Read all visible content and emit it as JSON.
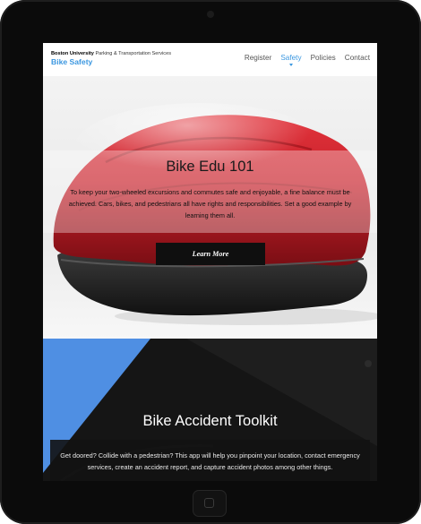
{
  "header": {
    "org_bold": "Boston University",
    "org_rest": "Parking & Transportation Services",
    "site_title": "Bike Safety"
  },
  "nav": {
    "items": [
      {
        "label": "Register",
        "active": false
      },
      {
        "label": "Safety",
        "active": true
      },
      {
        "label": "Policies",
        "active": false
      },
      {
        "label": "Contact",
        "active": false
      }
    ]
  },
  "hero": {
    "title": "Bike Edu 101",
    "body": "To keep your two-wheeled excursions and commutes safe and enjoyable, a fine balance must be achieved. Cars, bikes, and pedestrians all have rights and responsibilities. Set a good example by learning them all.",
    "button_label": "Learn More"
  },
  "toolkit": {
    "title": "Bike Accident Toolkit",
    "body": "Get doored? Collide with a pedestrian? This app will help you pinpoint your location, contact emergency services, create an accident report, and capture accident photos among other things."
  },
  "colors": {
    "accent": "#3b97e0",
    "toolkit_bg": "#4f8fe3",
    "helmet_red": "#c8202a"
  }
}
